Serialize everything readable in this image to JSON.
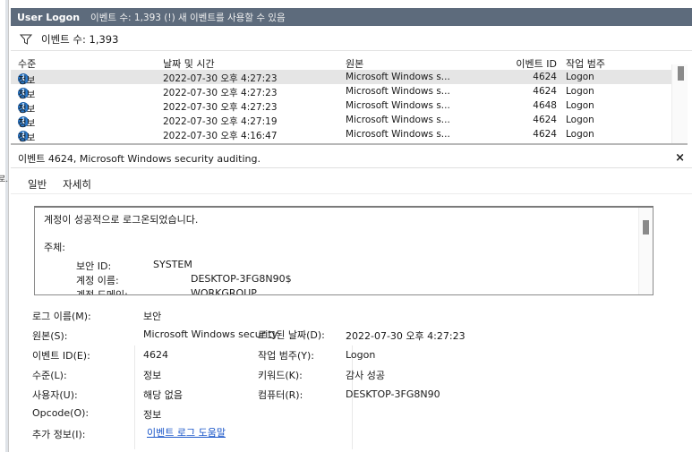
{
  "left_edge": {
    "fragment": "로."
  },
  "titlebar": {
    "name": "User Logon",
    "info": "이벤트 수: 1,393 (!) 새 이벤트를 사용할 수 있음"
  },
  "filter": {
    "count_label": "이벤트 수: 1,393"
  },
  "grid": {
    "columns": [
      "수준",
      "날짜 및 시간",
      "원본",
      "이벤트 ID",
      "작업 범주"
    ],
    "rows": [
      {
        "level": "정보",
        "date": "2022-07-30 오후 4:27:23",
        "source": "Microsoft Windows s...",
        "event_id": "4624",
        "category": "Logon",
        "selected": true
      },
      {
        "level": "정보",
        "date": "2022-07-30 오후 4:27:23",
        "source": "Microsoft Windows s...",
        "event_id": "4624",
        "category": "Logon"
      },
      {
        "level": "정보",
        "date": "2022-07-30 오후 4:27:23",
        "source": "Microsoft Windows s...",
        "event_id": "4648",
        "category": "Logon"
      },
      {
        "level": "정보",
        "date": "2022-07-30 오후 4:27:19",
        "source": "Microsoft Windows s...",
        "event_id": "4624",
        "category": "Logon"
      },
      {
        "level": "정보",
        "date": "2022-07-30 오후 4:16:47",
        "source": "Microsoft Windows s...",
        "event_id": "4624",
        "category": "Logon"
      }
    ]
  },
  "details": {
    "header": "이벤트 4624, Microsoft Windows security auditing.",
    "close_label": "×",
    "tabs": [
      "일반",
      "자세히"
    ],
    "description": {
      "summary": "계정이 성공적으로 로그온되었습니다.",
      "subject_label": "주체:",
      "security_id_label": "보안 ID:",
      "security_id_value": "SYSTEM",
      "account_name_label": "계정 이름:",
      "account_name_value": "DESKTOP-3FG8N90$",
      "account_domain_label": "계정 도메인:",
      "account_domain_value": "WORKGROUP"
    },
    "props": {
      "log_name_label": "로그 이름(M):",
      "log_name_value": "보안",
      "source_label": "원본(S):",
      "source_value": "Microsoft Windows security",
      "logged_label": "로그된 날짜(D):",
      "logged_value": "2022-07-30 오후 4:27:23",
      "event_id_label": "이벤트 ID(E):",
      "event_id_value": "4624",
      "task_category_label": "작업 범주(Y):",
      "task_category_value": "Logon",
      "level_label": "수준(L):",
      "level_value": "정보",
      "keywords_label": "키워드(K):",
      "keywords_value": "감사 성공",
      "user_label": "사용자(U):",
      "user_value": "해당 없음",
      "computer_label": "컴퓨터(R):",
      "computer_value": "DESKTOP-3FG8N90",
      "opcode_label": "Opcode(O):",
      "opcode_value": "정보",
      "more_info_label": "추가 정보(I):",
      "more_info_link": "이벤트 로그 도움말"
    }
  },
  "colors": {
    "titlebar": "#5d6b7c",
    "link": "#1a56c9",
    "selected_row": "#e5e5e5",
    "info_icon": "#2f7fd1"
  }
}
